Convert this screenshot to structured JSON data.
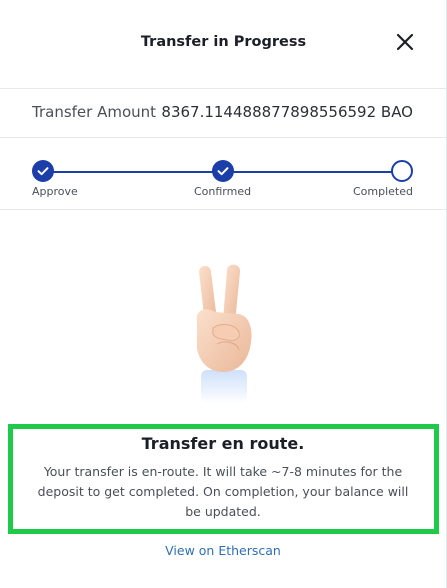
{
  "header": {
    "title": "Transfer in Progress",
    "close_icon": "close-icon"
  },
  "amount": {
    "label": "Transfer Amount",
    "value": "8367.114488877898556592 BAO"
  },
  "steps": [
    {
      "label": "Approve",
      "status": "done"
    },
    {
      "label": "Confirmed",
      "status": "done"
    },
    {
      "label": "Completed",
      "status": "pending"
    }
  ],
  "illustration": {
    "icon": "victory-hand-icon"
  },
  "message": {
    "title": "Transfer en route.",
    "body": "Your transfer is en-route. It will take ~7-8 minutes for the deposit to get completed. On completion, your balance will be updated."
  },
  "link": {
    "label": "View on Etherscan"
  },
  "colors": {
    "accent": "#1b3ea8",
    "highlight": "#1fc94a",
    "link": "#2f6fb5"
  }
}
